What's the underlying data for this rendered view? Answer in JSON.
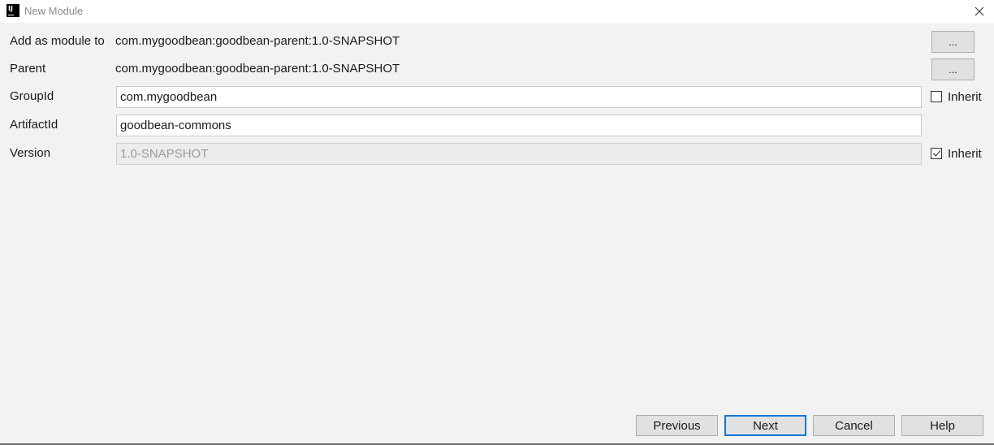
{
  "window": {
    "title": "New Module",
    "app_icon_text": "IJ"
  },
  "form": {
    "add_as_module_to": {
      "label": "Add as module to",
      "value": "com.mygoodbean:goodbean-parent:1.0-SNAPSHOT",
      "button_label": "..."
    },
    "parent": {
      "label": "Parent",
      "value": "com.mygoodbean:goodbean-parent:1.0-SNAPSHOT",
      "button_label": "..."
    },
    "group_id": {
      "label": "GroupId",
      "value": "com.mygoodbean",
      "inherit_label": "Inherit",
      "inherit_checked": false
    },
    "artifact_id": {
      "label": "ArtifactId",
      "value": "goodbean-commons"
    },
    "version": {
      "label": "Version",
      "value": "1.0-SNAPSHOT",
      "disabled": true,
      "inherit_label": "Inherit",
      "inherit_checked": true
    }
  },
  "footer": {
    "previous_label": "Previous",
    "next_label": "Next",
    "cancel_label": "Cancel",
    "help_label": "Help"
  },
  "colors": {
    "background": "#f2f2f2",
    "default_button_border": "#0078d7"
  },
  "icons": {
    "app": "intellij-idea-icon",
    "close": "close-icon"
  }
}
